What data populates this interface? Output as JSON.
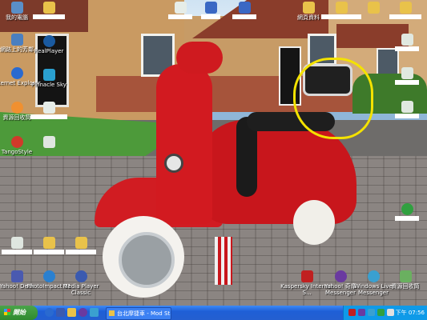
{
  "desktop_icons": [
    {
      "key": "my-computer",
      "label": "我的電腦",
      "masked": false,
      "icon": "computer-icon",
      "color": "#5a8fc8"
    },
    {
      "key": "network",
      "label": "網路上的芳鄰",
      "masked": false,
      "icon": "network-icon",
      "color": "#4a7fc0"
    },
    {
      "key": "ie",
      "label": "Internet Explorer",
      "masked": false,
      "icon": "ie-icon",
      "color": "#2a6ad0"
    },
    {
      "key": "recycle",
      "label": "資源回收筒",
      "masked": false,
      "icon": "recycle-bin-icon",
      "color": "#f09030"
    },
    {
      "key": "tango",
      "label": "TangoStyle",
      "masked": false,
      "icon": "tango-icon",
      "color": "#d03a2a"
    },
    {
      "key": "realplayer",
      "label": "RealPlayer",
      "masked": false,
      "icon": "realplayer-icon",
      "color": "#1a5aa0"
    },
    {
      "key": "pptv",
      "label": "Pinnacle Sky",
      "masked": false,
      "icon": "sky-icon",
      "color": "#2aa0d0"
    },
    {
      "key": "doc1",
      "label": "",
      "masked": true,
      "icon": "document-icon",
      "color": "#e6ede8"
    },
    {
      "key": "doc2",
      "label": "",
      "masked": true,
      "icon": "folder-icon",
      "color": "#e9c24a"
    },
    {
      "key": "doc3",
      "label": "",
      "masked": true,
      "icon": "document-icon",
      "color": "#dfe6e0"
    },
    {
      "key": "doc4",
      "label": "",
      "masked": true,
      "icon": "word-doc-icon",
      "color": "#3a68c4"
    },
    {
      "key": "doc5",
      "label": "",
      "masked": true,
      "icon": "word-doc-icon",
      "color": "#3a68c4"
    },
    {
      "key": "doc6",
      "label": "網頁資料",
      "masked": false,
      "icon": "folder-icon",
      "color": "#e9c24a"
    },
    {
      "key": "doc7",
      "label": "",
      "masked": true,
      "icon": "folder-icon",
      "color": "#e9c24a"
    },
    {
      "key": "doc8",
      "label": "",
      "masked": true,
      "icon": "folder-icon",
      "color": "#e9c24a"
    },
    {
      "key": "doc9",
      "label": "",
      "masked": true,
      "icon": "folder-icon",
      "color": "#e9c24a"
    },
    {
      "key": "note1",
      "label": "",
      "masked": true,
      "icon": "document-icon",
      "color": "#e0e8e0"
    },
    {
      "key": "note2",
      "label": "",
      "masked": true,
      "icon": "document-icon",
      "color": "#e0e8e0"
    },
    {
      "key": "note3",
      "label": "",
      "masked": true,
      "icon": "document-icon",
      "color": "#e0e8e0"
    },
    {
      "key": "shortcut1",
      "label": "",
      "masked": true,
      "icon": "folder-icon",
      "color": "#e9c24a"
    },
    {
      "key": "shortcut2",
      "label": "",
      "masked": true,
      "icon": "folder-icon",
      "color": "#e9c24a"
    },
    {
      "key": "yahoo-desk",
      "label": "Yahoo! Desk",
      "masked": false,
      "icon": "yahoo-desk-icon",
      "color": "#4a5ab0"
    },
    {
      "key": "photoimpact",
      "label": "PhotoImpact 11",
      "masked": false,
      "icon": "photoimpact-icon",
      "color": "#2a80d0"
    },
    {
      "key": "media-player",
      "label": "Media Player Classic",
      "masked": false,
      "icon": "media-player-icon",
      "color": "#3a5ab0"
    },
    {
      "key": "kaspersky",
      "label": "Kaspersky Internet S...",
      "masked": false,
      "icon": "kaspersky-icon",
      "color": "#c02020"
    },
    {
      "key": "yahoo-messenger",
      "label": "Yahoo! 奇摩 Messenger",
      "masked": false,
      "icon": "yahoo-messenger-icon",
      "color": "#6a3aa0"
    },
    {
      "key": "wlm",
      "label": "Windows Live Messenger",
      "masked": false,
      "icon": "windows-live-messenger-icon",
      "color": "#3aa0d0"
    },
    {
      "key": "recycle2",
      "label": "資源回收筒",
      "masked": false,
      "icon": "recycle-bin-icon",
      "color": "#6ab060"
    },
    {
      "key": "right-icon",
      "label": "",
      "masked": true,
      "icon": "app-icon",
      "color": "#30a040"
    }
  ],
  "taskbar": {
    "start_label": "開始",
    "task_label": "台北摩捷車 - Mod St...",
    "clock": "下午 07:56"
  },
  "colors": {
    "highlight": "#f4e200",
    "taskbar": "#245fd0",
    "tray": "#0f9ae8",
    "start": "#2e8a2e"
  }
}
